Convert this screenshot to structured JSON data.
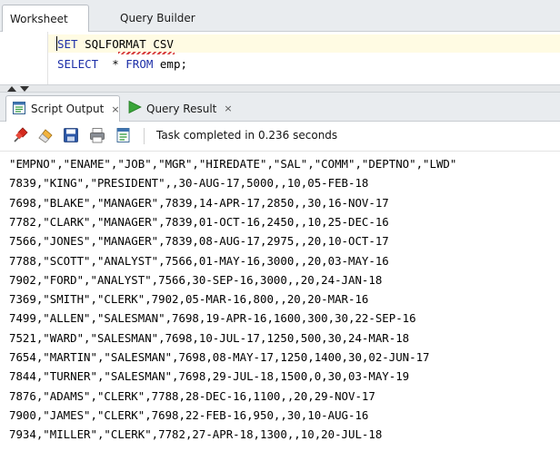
{
  "tabs": {
    "worksheet": "Worksheet",
    "query_builder": "Query Builder"
  },
  "editor": {
    "line1_kw": "SET",
    "line1_rest": " SQLFORMAT CSV",
    "line2_kw1": "SELECT",
    "line2_mid": "  * ",
    "line2_kw2": "FROM",
    "line2_rest": " emp;"
  },
  "output_tabs": {
    "script_output": "Script Output",
    "query_result": "Query Result",
    "close_glyph": "×"
  },
  "toolbar": {
    "icons": [
      "pin-icon",
      "eraser-icon",
      "save-icon",
      "print-icon",
      "export-icon"
    ],
    "status": "Task completed in 0.236 seconds"
  },
  "colors": {
    "keyword": "#1d2fa8",
    "tab_bar": "#e9ecef",
    "run_green": "#3aa53a"
  },
  "output_lines": [
    "\"EMPNO\",\"ENAME\",\"JOB\",\"MGR\",\"HIREDATE\",\"SAL\",\"COMM\",\"DEPTNO\",\"LWD\"",
    "7839,\"KING\",\"PRESIDENT\",,30-AUG-17,5000,,10,05-FEB-18",
    "7698,\"BLAKE\",\"MANAGER\",7839,14-APR-17,2850,,30,16-NOV-17",
    "7782,\"CLARK\",\"MANAGER\",7839,01-OCT-16,2450,,10,25-DEC-16",
    "7566,\"JONES\",\"MANAGER\",7839,08-AUG-17,2975,,20,10-OCT-17",
    "7788,\"SCOTT\",\"ANALYST\",7566,01-MAY-16,3000,,20,03-MAY-16",
    "7902,\"FORD\",\"ANALYST\",7566,30-SEP-16,3000,,20,24-JAN-18",
    "7369,\"SMITH\",\"CLERK\",7902,05-MAR-16,800,,20,20-MAR-16",
    "7499,\"ALLEN\",\"SALESMAN\",7698,19-APR-16,1600,300,30,22-SEP-16",
    "7521,\"WARD\",\"SALESMAN\",7698,10-JUL-17,1250,500,30,24-MAR-18",
    "7654,\"MARTIN\",\"SALESMAN\",7698,08-MAY-17,1250,1400,30,02-JUN-17",
    "7844,\"TURNER\",\"SALESMAN\",7698,29-JUL-18,1500,0,30,03-MAY-19",
    "7876,\"ADAMS\",\"CLERK\",7788,28-DEC-16,1100,,20,29-NOV-17",
    "7900,\"JAMES\",\"CLERK\",7698,22-FEB-16,950,,30,10-AUG-16",
    "7934,\"MILLER\",\"CLERK\",7782,27-APR-18,1300,,10,20-JUL-18"
  ]
}
